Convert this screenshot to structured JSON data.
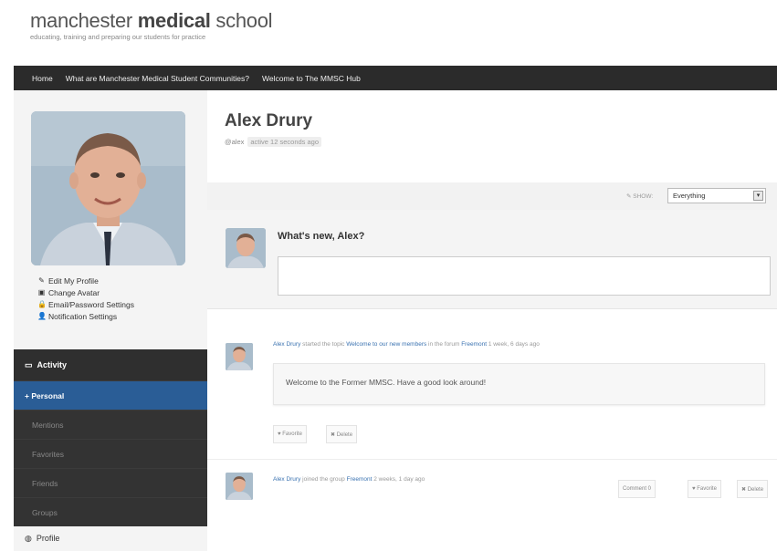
{
  "site": {
    "logo_light": "manchester ",
    "logo_bold": "medical",
    "logo_tail": " school",
    "tagline": "educating, training and preparing our students for practice"
  },
  "nav": {
    "items": [
      "Home",
      "What are Manchester Medical Student Communities?",
      "Welcome to The MMSC Hub"
    ]
  },
  "sidebar": {
    "links": [
      {
        "icon": "pencil-icon",
        "glyph": "✎",
        "label": "Edit My Profile"
      },
      {
        "icon": "image-icon",
        "glyph": "▣",
        "label": "Change Avatar"
      },
      {
        "icon": "lock-icon",
        "glyph": "🔒",
        "label": "Email/Password Settings"
      },
      {
        "icon": "user-icon",
        "glyph": "👤",
        "label": "Notification Settings"
      }
    ],
    "menu_head": "Activity",
    "menu_items": [
      "+ Personal",
      "Mentions",
      "Favorites",
      "Friends",
      "Groups"
    ],
    "menu_foot": "Profile"
  },
  "profile": {
    "name": "Alex Drury",
    "handle": "@alex",
    "active": "active 12 seconds ago"
  },
  "filter": {
    "show_label": "✎ SHOW:",
    "selected": "Everything"
  },
  "post_form": {
    "prompt": "What's new, Alex?"
  },
  "activities": [
    {
      "actor": "Alex Drury",
      "pre": " started the topic ",
      "topic": "Welcome to our new members",
      "mid": " in the forum ",
      "place": "Freemont",
      "time": " 1 week, 6 days ago",
      "content": "Welcome to the Former MMSC. Have a good look around!",
      "buttons": [
        "♥ Favorite",
        "✖ Delete"
      ]
    },
    {
      "actor": "Alex Drury",
      "pre": " joined the group ",
      "place": "Freemont",
      "time": " 2 weeks, 1 day ago",
      "buttons": [
        "Comment 0",
        "♥ Favorite",
        "✖ Delete"
      ]
    }
  ],
  "colors": {
    "nav_bg": "#2b2b2b",
    "active_menu": "#2a5d96",
    "link": "#3a72b0"
  }
}
